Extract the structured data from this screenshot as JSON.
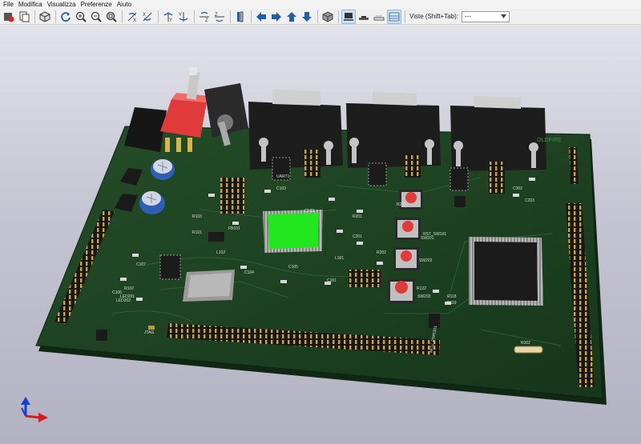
{
  "menu": [
    "File",
    "Modifica",
    "Visualizza",
    "Preferenze",
    "Aiuto"
  ],
  "toolbar": {
    "views_label": "Viste (Shift+Tab):",
    "views_selected": "---"
  },
  "board": {
    "brand": "OLDFIRE",
    "labels": {
      "r302": "R302",
      "sw201": "SW201",
      "sw202": "SW202",
      "sw203": "SW203",
      "sw301": "RST_SW101",
      "r201": "R201",
      "r202": "R202",
      "r203": "R203",
      "r101": "R101",
      "r102": "R102",
      "r103": "R103",
      "l101": "L101",
      "l102": "L102",
      "fb101": "FB101",
      "c101": "C101",
      "c102": "C102",
      "c103": "C103",
      "c104": "C104",
      "c105": "C105",
      "c106": "C106",
      "c107": "C107",
      "c201": "C201",
      "c202": "C202",
      "c203": "C203",
      "ld201": "LED201",
      "ld202": "LED202",
      "r122": "R122",
      "r118": "R118",
      "r119": "R119",
      "mcu_pwr": "MCU_PWR301",
      "uart": "UART1",
      "jtag": "JTAG"
    }
  },
  "colors": {
    "pcb": "#1c3f20",
    "pcb_edge": "#0f2713",
    "chip_green": "#22e61e",
    "switch_red": "#e03a3a",
    "connector_body": "#1d1d1d",
    "pin_gold": "#c9a24a"
  },
  "axes": {
    "x": "red",
    "y": "blue",
    "z": "blue"
  }
}
